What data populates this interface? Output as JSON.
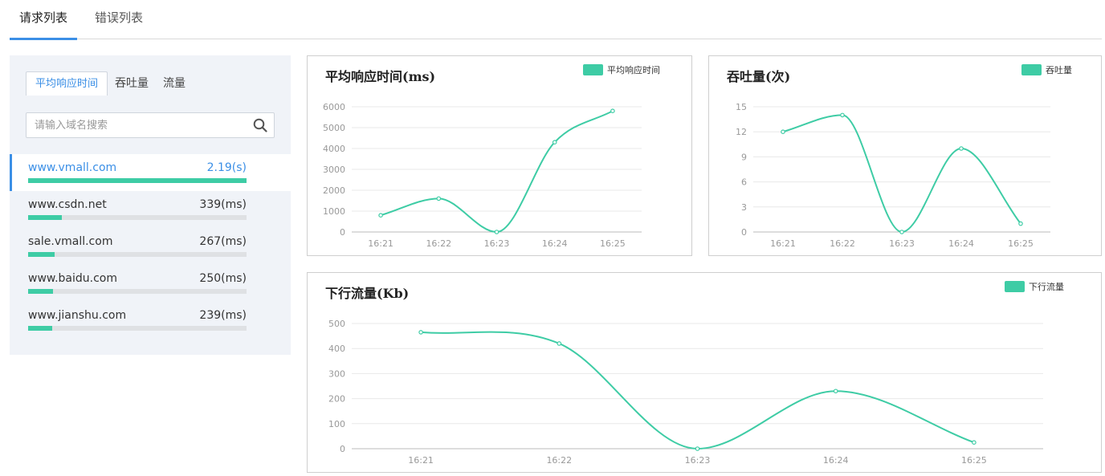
{
  "top_tabs": [
    {
      "label": "请求列表",
      "active": true
    },
    {
      "label": "错误列表",
      "active": false
    }
  ],
  "sub_tabs": [
    {
      "label": "平均响应时间",
      "active": true
    },
    {
      "label": "吞吐量",
      "active": false
    },
    {
      "label": "流量",
      "active": false
    }
  ],
  "search": {
    "placeholder": "请输入域名搜索",
    "value": "",
    "icon": "search-icon"
  },
  "domains": [
    {
      "name": "www.vmall.com",
      "value": "2.19(s)",
      "fraction": 1.0,
      "active": true
    },
    {
      "name": "www.csdn.net",
      "value": "339(ms)",
      "fraction": 0.155,
      "active": false
    },
    {
      "name": "sale.vmall.com",
      "value": "267(ms)",
      "fraction": 0.122,
      "active": false
    },
    {
      "name": "www.baidu.com",
      "value": "250(ms)",
      "fraction": 0.114,
      "active": false
    },
    {
      "name": "www.jianshu.com",
      "value": "239(ms)",
      "fraction": 0.109,
      "active": false
    }
  ],
  "colors": {
    "accent": "#3b8fe6",
    "series": "#3ecca5",
    "grid": "#e8e8e8",
    "axis": "#bbbbbb"
  },
  "chart_data": [
    {
      "type": "line",
      "title": "平均响应时间(ms)",
      "categories": [
        "16:21",
        "16:22",
        "16:23",
        "16:24",
        "16:25"
      ],
      "series": [
        {
          "name": "平均响应时间",
          "values": [
            800,
            1600,
            0,
            4300,
            5800
          ]
        }
      ],
      "ylim": [
        0,
        6000
      ],
      "yticks": [
        0,
        1000,
        2000,
        3000,
        4000,
        5000,
        6000
      ],
      "grid": true,
      "legend": "top-right",
      "smooth": true
    },
    {
      "type": "line",
      "title": "吞吐量(次)",
      "categories": [
        "16:21",
        "16:22",
        "16:23",
        "16:24",
        "16:25"
      ],
      "series": [
        {
          "name": "吞吐量",
          "values": [
            12,
            14,
            0,
            10,
            1
          ]
        }
      ],
      "ylim": [
        0,
        15
      ],
      "yticks": [
        0,
        3,
        6,
        9,
        12,
        15
      ],
      "grid": true,
      "legend": "top-right",
      "smooth": true
    },
    {
      "type": "line",
      "title": "下行流量(Kb)",
      "categories": [
        "16:21",
        "16:22",
        "16:23",
        "16:24",
        "16:25"
      ],
      "series": [
        {
          "name": "下行流量",
          "values": [
            465,
            420,
            0,
            230,
            25
          ]
        }
      ],
      "ylim": [
        0,
        500
      ],
      "yticks": [
        0,
        100,
        200,
        300,
        400,
        500
      ],
      "grid": true,
      "legend": "top-right",
      "smooth": true
    }
  ]
}
